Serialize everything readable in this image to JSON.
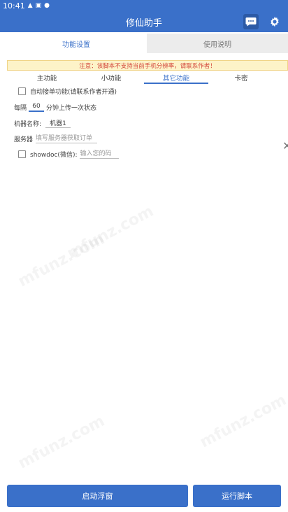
{
  "status_bar": {
    "time": "10:41"
  },
  "app_bar": {
    "title": "修仙助手",
    "chat_icon": "chat-bubble-icon",
    "settings_icon": "gear-icon"
  },
  "main_tabs": [
    {
      "label": "功能设置",
      "active": true
    },
    {
      "label": "使用说明",
      "active": false
    }
  ],
  "notice": {
    "text": "注意：该脚本不支持当前手机分辨率，请联系作者！"
  },
  "sub_tabs": [
    {
      "label": "主功能"
    },
    {
      "label": "小功能"
    },
    {
      "label": "其它功能"
    },
    {
      "label": "卡密"
    }
  ],
  "options": {
    "auto_order_label": "自动接单功能(请联系作者开通)",
    "interval_prefix": "每隔",
    "interval_value": "60",
    "interval_suffix": "分钟上传一次状态",
    "machine_name_label": "机器名称:",
    "machine_name_value": "机器1",
    "server_label": "服务器",
    "server_placeholder": "填写服务器获取订单",
    "showdoc_label": "showdoc(微信):",
    "showdoc_placeholder": "输入您的码"
  },
  "watermark": "mfunz.com",
  "buttons": {
    "float_window": "启动浮窗",
    "run_script": "运行脚本"
  }
}
